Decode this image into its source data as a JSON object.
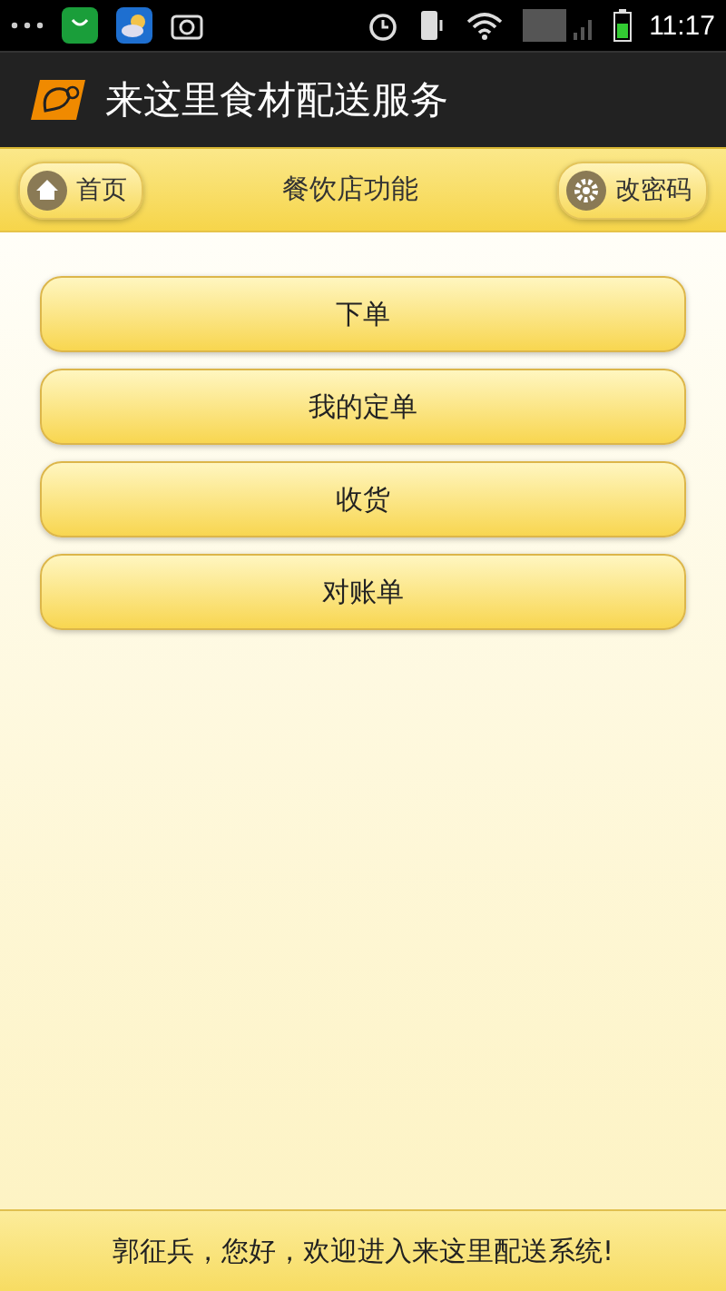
{
  "status_bar": {
    "time": "11:17"
  },
  "app_bar": {
    "title": "来这里食材配送服务"
  },
  "nav_bar": {
    "back_button": "首页",
    "title": "餐饮店功能",
    "settings_button": "改密码"
  },
  "menu": [
    {
      "label": "下单"
    },
    {
      "label": "我的定单"
    },
    {
      "label": "收货"
    },
    {
      "label": "对账单"
    }
  ],
  "footer": {
    "message": "郭征兵，您好，欢迎进入来这里配送系统!"
  }
}
